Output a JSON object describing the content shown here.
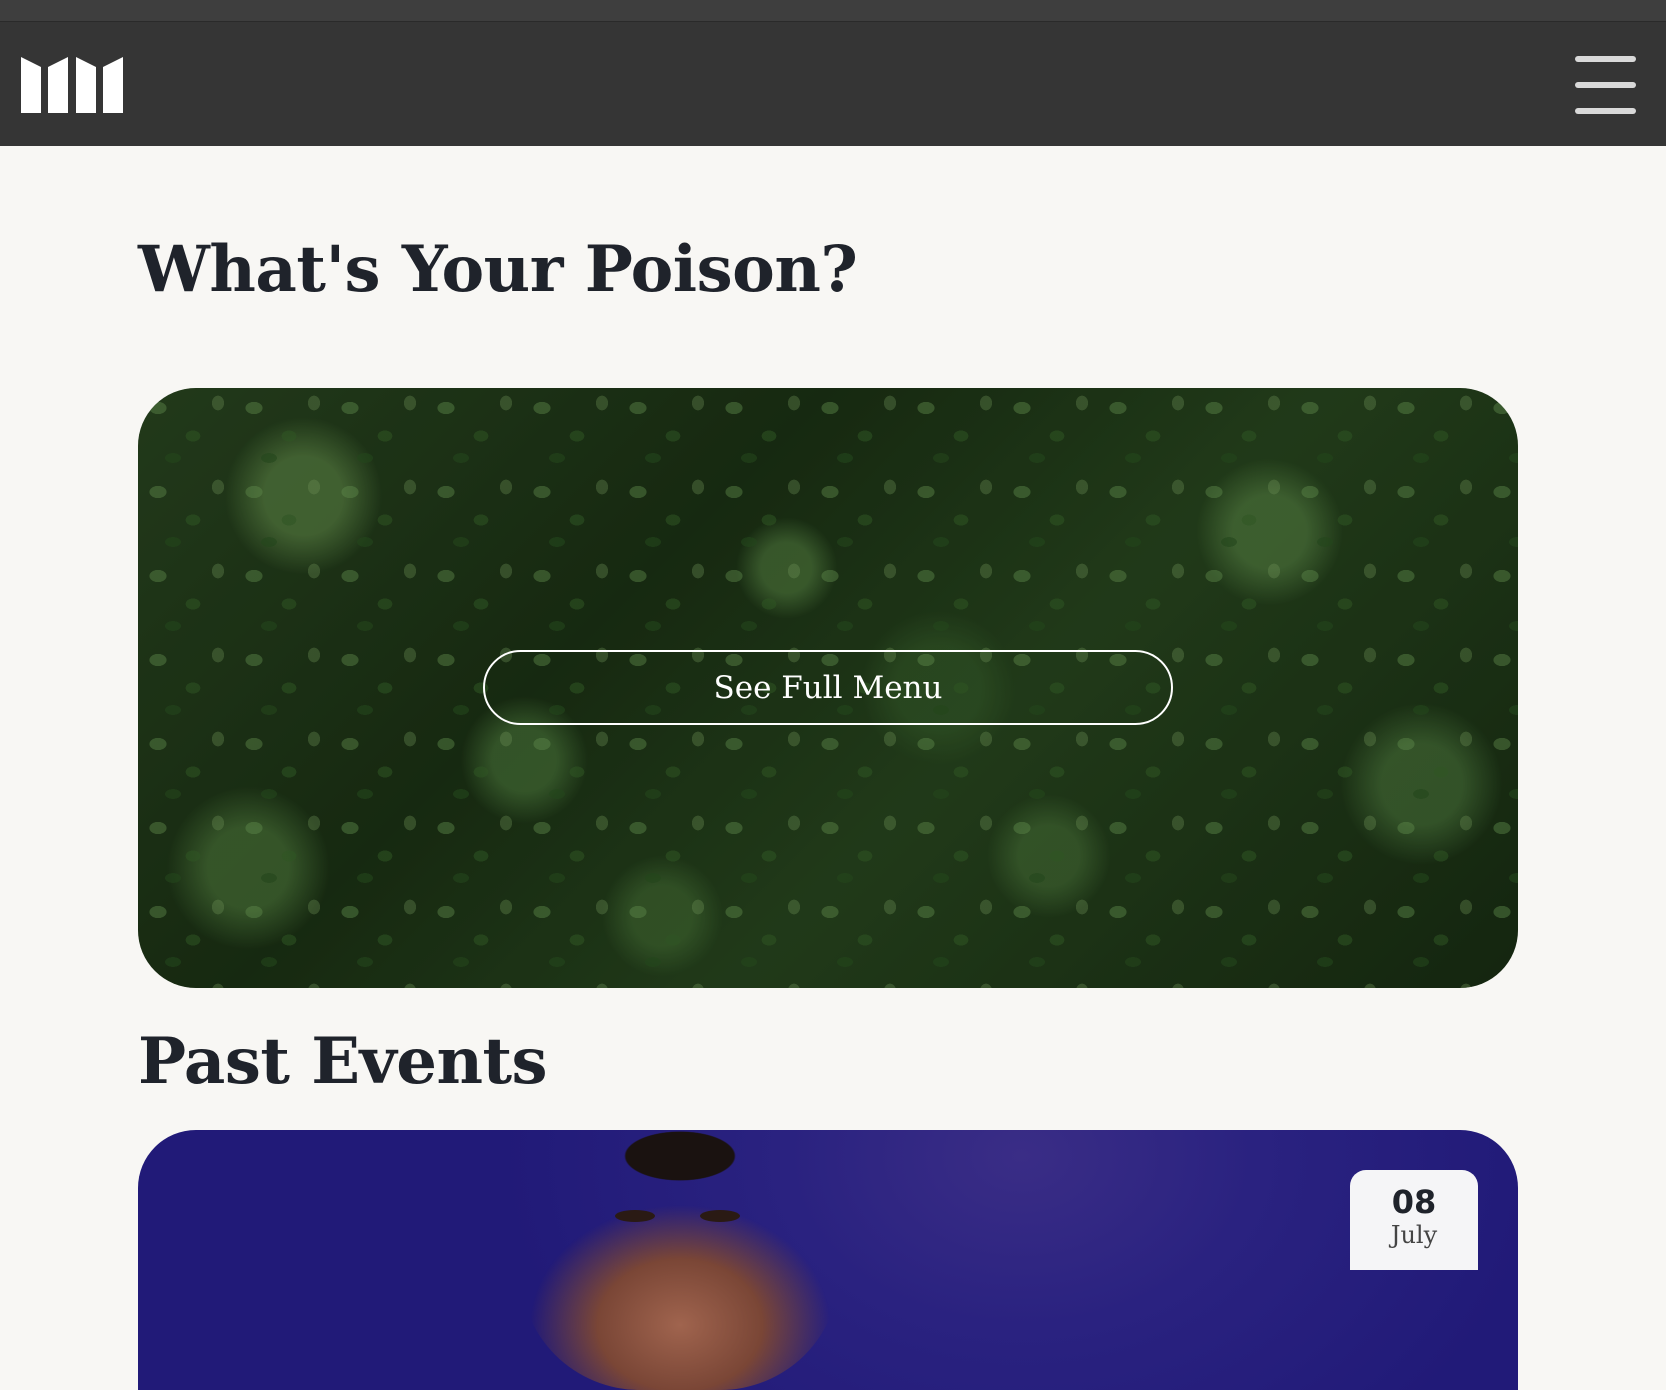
{
  "header": {
    "logo_name": "brand-logo",
    "menu_icon": "hamburger-menu-icon"
  },
  "menu_section": {
    "title": "What's Your Poison?",
    "button_label": "See Full Menu"
  },
  "events_section": {
    "title": "Past Events",
    "event": {
      "day": "08",
      "month": "July"
    }
  },
  "colors": {
    "navbar": "#353535",
    "page_background": "#f8f7f4",
    "heading": "#1f232b",
    "event_background": "#2a2280"
  }
}
